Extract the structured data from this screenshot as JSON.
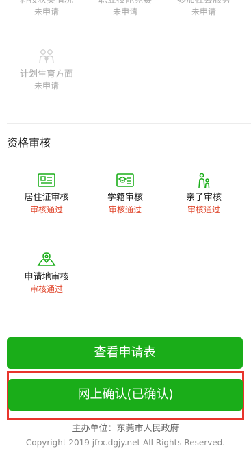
{
  "applications": {
    "items": [
      {
        "label": "科技获奖情况",
        "status": "未申请"
      },
      {
        "label": "职业技能竞赛",
        "status": "未申请"
      },
      {
        "label": "参加社会服务",
        "status": "未申请"
      },
      {
        "label": "计划生育方面",
        "status": "未申请",
        "icon": "family-icon"
      }
    ]
  },
  "qualification": {
    "title": "资格审核",
    "items": [
      {
        "label": "居住证审核",
        "status": "审核通过",
        "icon": "id-card-icon"
      },
      {
        "label": "学籍审核",
        "status": "审核通过",
        "icon": "student-card-icon"
      },
      {
        "label": "亲子审核",
        "status": "审核通过",
        "icon": "parent-child-icon"
      },
      {
        "label": "申请地审核",
        "status": "审核通过",
        "icon": "map-pin-icon"
      }
    ]
  },
  "buttons": {
    "view_form": "查看申请表",
    "online_confirm": "网上确认(已确认)"
  },
  "footer": {
    "organizer": "主办单位：东莞市人民政府",
    "copyright": "Copyright 2019 jfrx.dgjy.net All Rights Reserved."
  },
  "colors": {
    "accent_green": "#1aad19",
    "approved_red": "#e0492f",
    "highlight_border": "#e8352c",
    "muted_gray": "#a8a8a8"
  }
}
